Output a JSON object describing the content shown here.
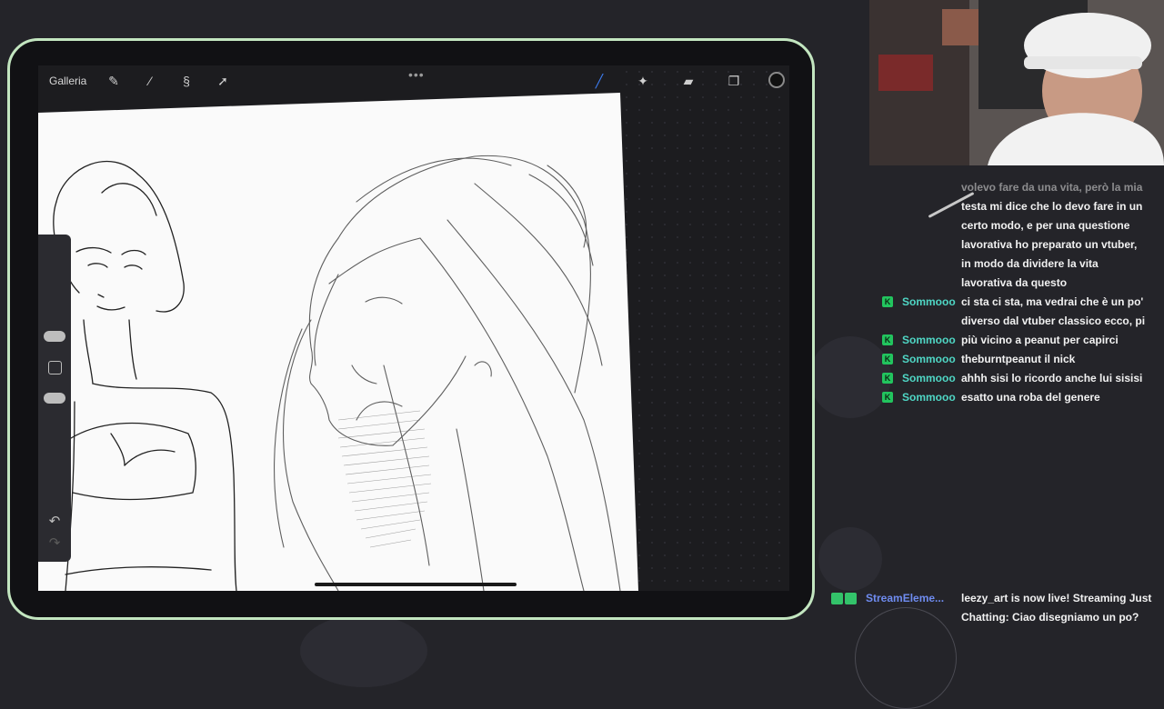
{
  "procreate": {
    "gallery_label": "Galleria",
    "tools_left": [
      "wrench-icon",
      "magic-wand-icon",
      "selection-icon",
      "transform-arrow-icon"
    ],
    "tools_right": [
      "brush-icon",
      "smudge-icon",
      "eraser-icon",
      "layers-icon",
      "color-swatch-icon"
    ],
    "more_dots": "•••",
    "sidebar_icons": [
      "undo-icon",
      "redo-icon"
    ]
  },
  "chat": {
    "partial_message_lines": [
      "volevo fare da una vita, però la mia",
      "testa mi dice che lo devo fare in un",
      "certo modo, e per una questione",
      "lavorativa ho preparato un vtuber,",
      "in modo da dividere la vita",
      "lavorativa da questo"
    ],
    "messages": [
      {
        "user": "Sommooo",
        "text": "ci sta ci sta, ma vedrai che è un po'",
        "cont": "diverso dal vtuber classico ecco, pi"
      },
      {
        "user": "Sommooo",
        "text": "più vicino a peanut per capirci"
      },
      {
        "user": "Sommooo",
        "text": "theburntpeanut il nick"
      },
      {
        "user": "Sommooo",
        "text": "ahhh sisi lo ricordo anche lui sisisi"
      },
      {
        "user": "Sommooo",
        "text": "esatto una roba del genere"
      }
    ],
    "badge_letter": "K",
    "streamelements": {
      "user": "StreamEleme...",
      "text": "leezy_art is now live! Streaming Just Chatting: Ciao disegniamo un po?"
    }
  },
  "colors": {
    "tablet_frame": "#c3e6c0",
    "chat_username": "#4fd7c5",
    "bot_username": "#6f8cf0",
    "badge_green": "#22c45e"
  }
}
